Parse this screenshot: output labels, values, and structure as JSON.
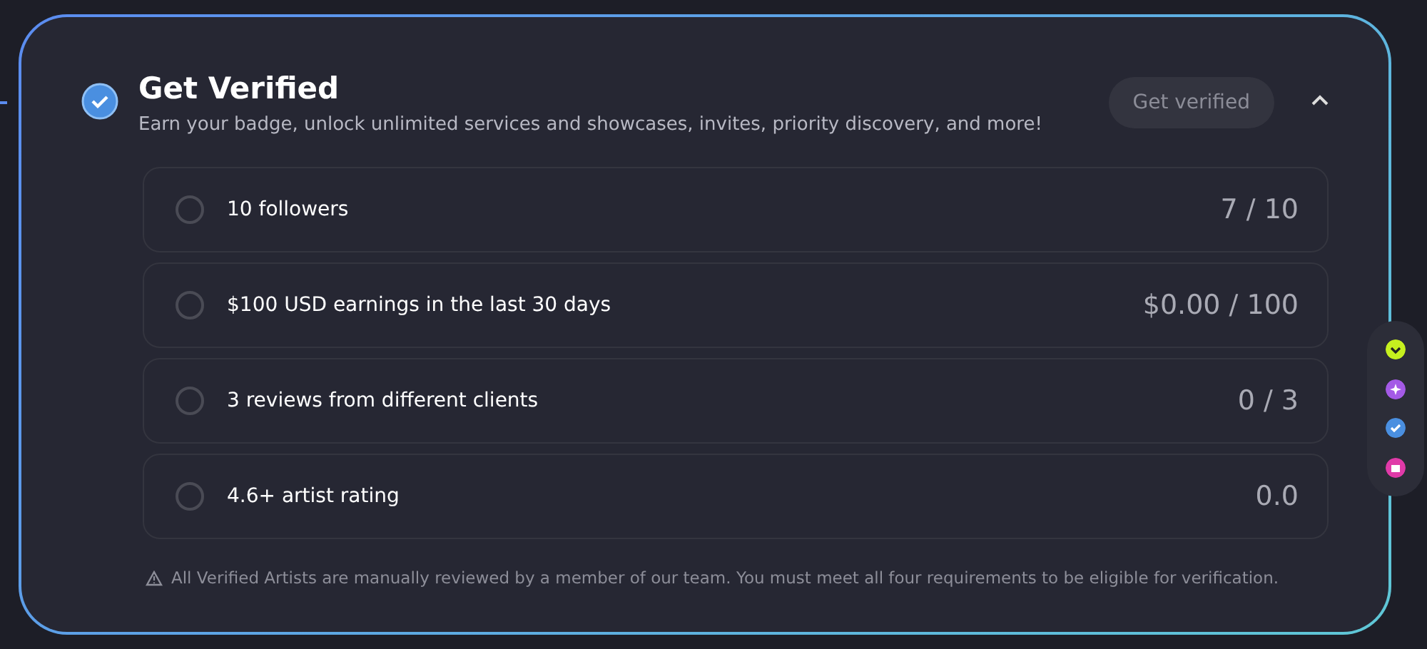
{
  "card": {
    "title": "Get Verified",
    "subtitle": "Earn your badge, unlock unlimited services and showcases, invites, priority discovery, and more!",
    "button": {
      "label": "Get verified",
      "disabled": true
    },
    "expanded": true
  },
  "requirements": [
    {
      "label": "10 followers",
      "progress": "7 / 10",
      "completed": false
    },
    {
      "label": "$100 USD earnings in the last 30 days",
      "progress": "$0.00 / 100",
      "completed": false
    },
    {
      "label": "3 reviews from different clients",
      "progress": "0 / 3",
      "completed": false
    },
    {
      "label": "4.6+ artist rating",
      "progress": "0.0",
      "completed": false
    }
  ],
  "note": "All Verified Artists are manually reviewed by a member of our team. You must meet all four requirements to be eligible for verification.",
  "side_rail": [
    {
      "kind": "chevron",
      "color": "#c6f01f"
    },
    {
      "kind": "sparkle",
      "color": "#a45ae6"
    },
    {
      "kind": "check",
      "color": "#4a8fe0"
    },
    {
      "kind": "store",
      "color": "#e03aa8"
    }
  ]
}
